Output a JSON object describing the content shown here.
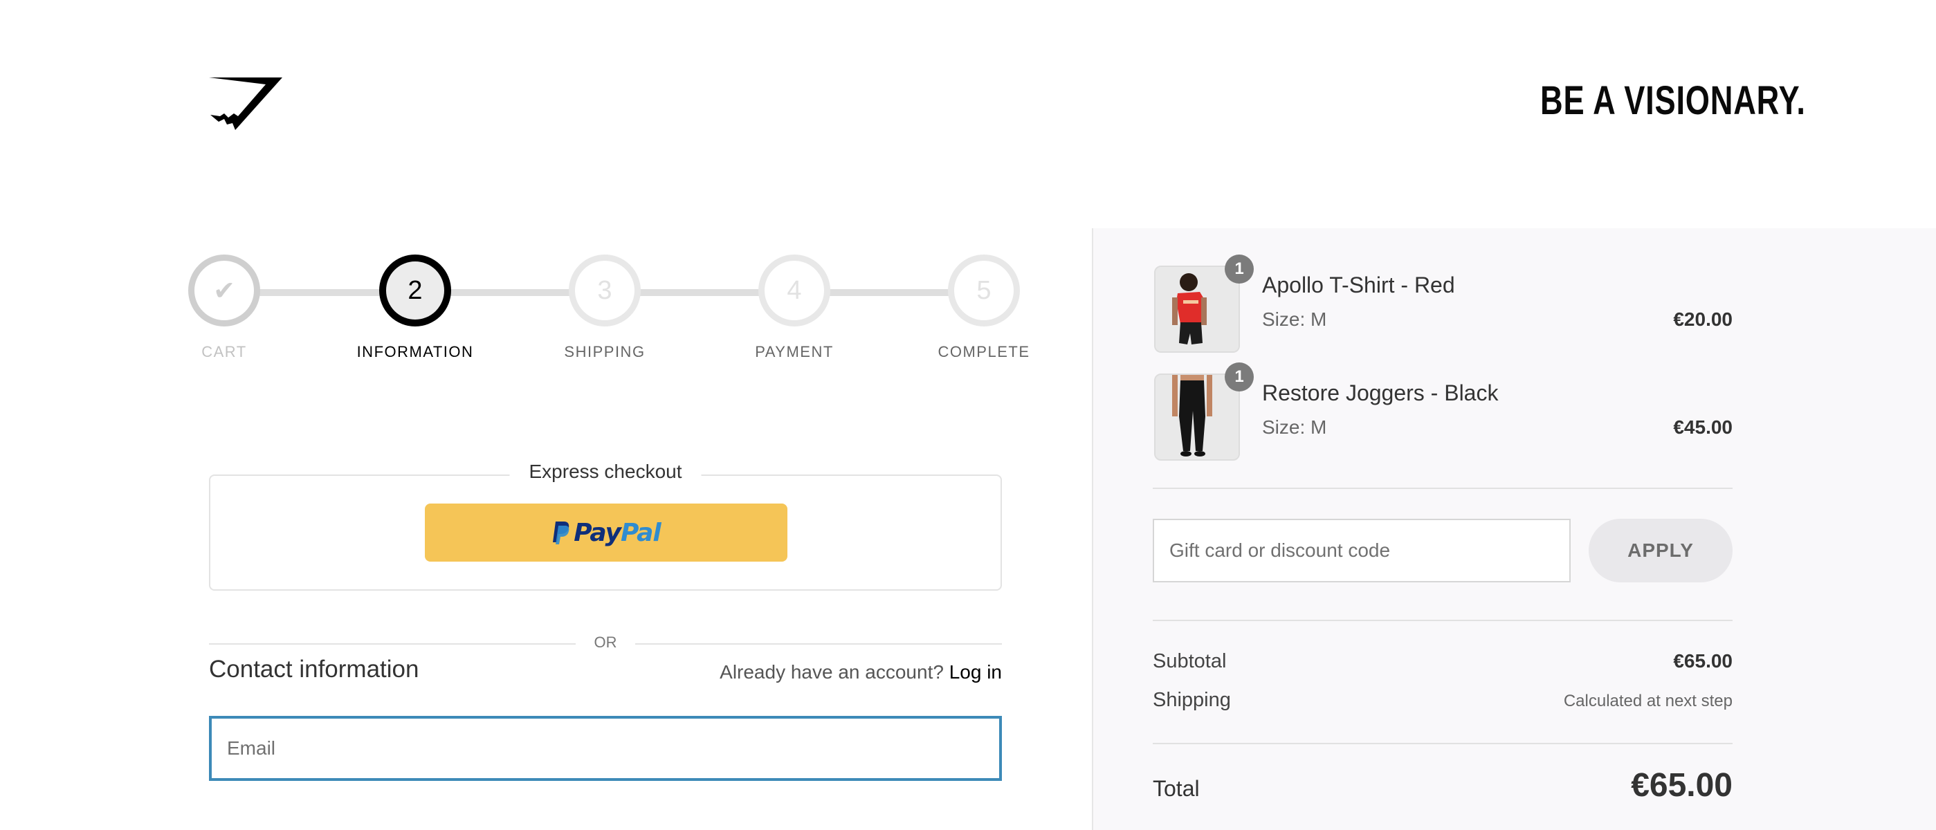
{
  "header": {
    "logo_icon": "gymshark-shark-logo",
    "tagline": "BE A VISIONARY."
  },
  "steps": [
    {
      "number": "✔",
      "label": "CART",
      "state": "done",
      "icon": "check-icon"
    },
    {
      "number": "2",
      "label": "INFORMATION",
      "state": "active"
    },
    {
      "number": "3",
      "label": "SHIPPING",
      "state": "upcoming"
    },
    {
      "number": "4",
      "label": "PAYMENT",
      "state": "upcoming"
    },
    {
      "number": "5",
      "label": "COMPLETE",
      "state": "upcoming"
    }
  ],
  "express": {
    "title": "Express checkout",
    "paypal_pay": "Pay",
    "paypal_pal": "Pal",
    "paypal_color_bg": "#f5c557",
    "paypal_color_dark": "#0f2f7a",
    "paypal_color_light": "#2f8cd0"
  },
  "divider_or": "OR",
  "contact": {
    "title": "Contact information",
    "login_prompt": "Already have an account?",
    "login_link": "Log in",
    "email_placeholder": "Email",
    "focus_color": "#3d8ab8"
  },
  "summary": {
    "items": [
      {
        "name": "Apollo T-Shirt - Red",
        "size": "Size: M",
        "price": "€20.00",
        "quantity": "1"
      },
      {
        "name": "Restore Joggers - Black",
        "size": "Size: M",
        "price": "€45.00",
        "quantity": "1"
      }
    ],
    "discount_placeholder": "Gift card or discount code",
    "apply_label": "APPLY",
    "subtotal_label": "Subtotal",
    "subtotal_value": "€65.00",
    "shipping_label": "Shipping",
    "shipping_value": "Calculated at next step",
    "total_label": "Total",
    "total_value": "€65.00"
  }
}
